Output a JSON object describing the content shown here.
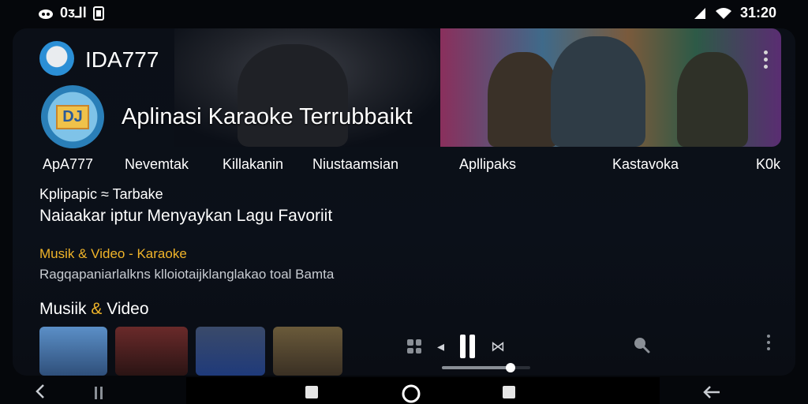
{
  "status_bar": {
    "left_text": "0ᴣ⅃l",
    "time": "31:20",
    "icons": [
      "cloud-icon",
      "notification-icon",
      "signal-icon",
      "wifi-icon"
    ]
  },
  "app": {
    "name": "IDA777",
    "headline": "Aplinasi Karaoke Terrubbaikt"
  },
  "tabs": [
    {
      "label": "ApA777"
    },
    {
      "label": "Nevemtak"
    },
    {
      "label": "Killakanin"
    },
    {
      "label": "Niustaamsian"
    },
    {
      "label": "Apllipaks"
    },
    {
      "label": "Kastavoka"
    },
    {
      "label": "K0k"
    }
  ],
  "info": {
    "subtitle": "Kplipapic ≈ Tarbake",
    "tagline": "Naiaakar iptur Menyaykan Lagu Favoriit",
    "category": "Musik & Video - Karaoke",
    "description": "Ragqapaniarlalkns klloiotaijklanglakao toal Bamta"
  },
  "section": {
    "title_part1": "Musiik ",
    "title_amp": "&",
    "title_part2": " Video"
  },
  "player": {
    "progress": 0.78
  },
  "colors": {
    "accent": "#f0b429",
    "background": "#05070b",
    "card": "#0b0f17"
  }
}
